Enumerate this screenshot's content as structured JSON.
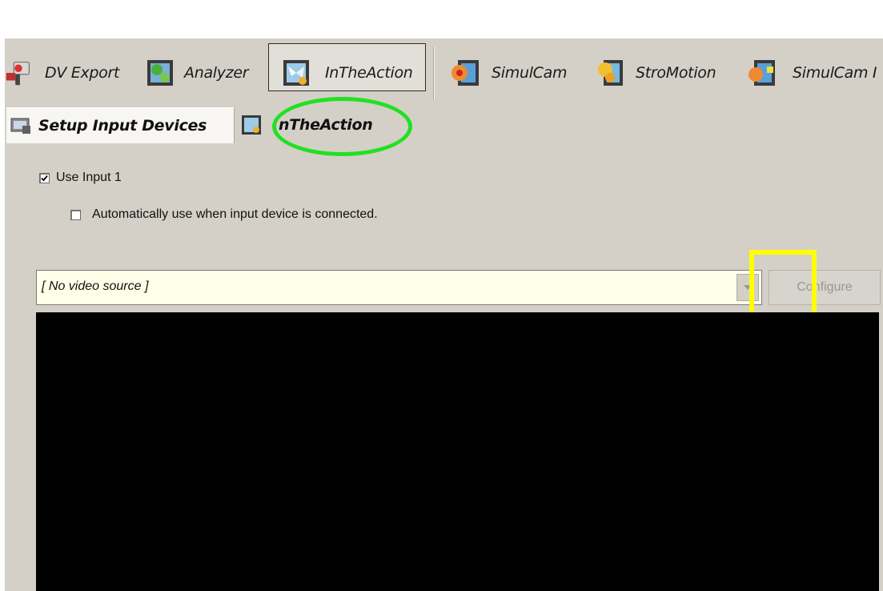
{
  "toolbar": {
    "items": [
      {
        "label": "DV Export",
        "icon": "dv-export-icon"
      },
      {
        "label": "Analyzer",
        "icon": "analyzer-icon"
      },
      {
        "label": "InTheAction",
        "icon": "intheaction-icon",
        "active": true
      },
      {
        "label": "SimulCam",
        "icon": "simulcam-icon"
      },
      {
        "label": "StroMotion",
        "icon": "stromotion-icon"
      },
      {
        "label": "SimulCam I",
        "icon": "simulcam-2-icon"
      }
    ]
  },
  "tabs": {
    "setup_label": "Setup Input Devices",
    "action_label": "nTheAction"
  },
  "input": {
    "use_input_label": "Use Input 1",
    "use_input_checked": true,
    "auto_label": "Automatically use when input device is connected.",
    "auto_checked": false
  },
  "source": {
    "value": "[ No video source ]",
    "configure_label": "Configure"
  },
  "annotations": {
    "highlight_ellipse_color": "#22e022",
    "highlight_rect_color": "#ffff00"
  }
}
